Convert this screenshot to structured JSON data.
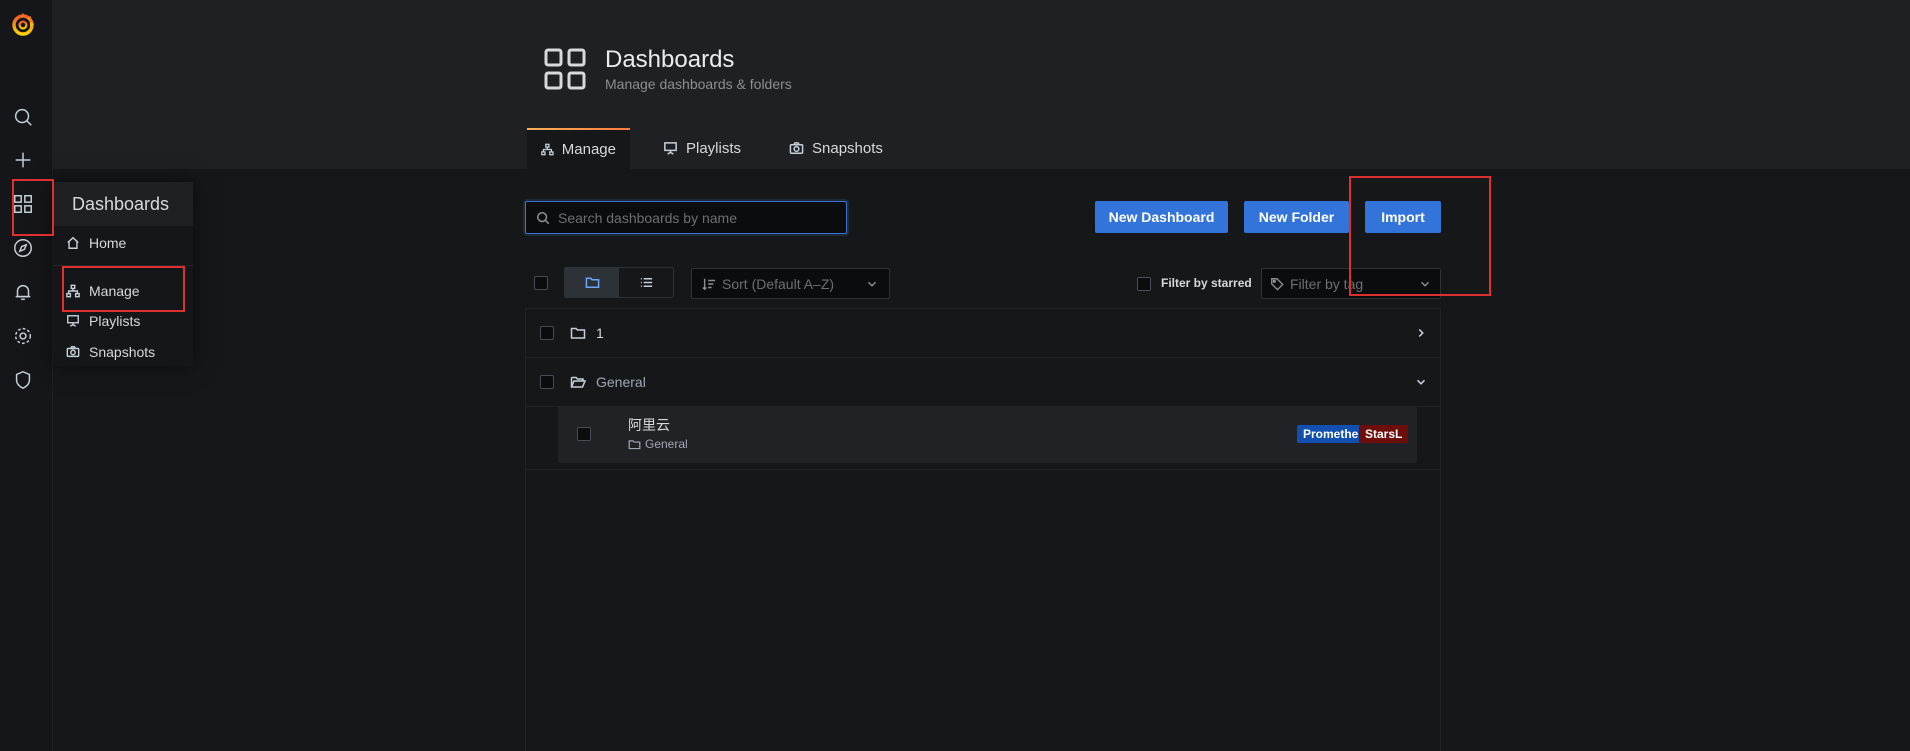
{
  "header": {
    "title": "Dashboards",
    "subtitle": "Manage dashboards & folders"
  },
  "tabs": [
    {
      "label": "Manage",
      "icon": "sitemap-icon",
      "active": true
    },
    {
      "label": "Playlists",
      "icon": "presentation-icon"
    },
    {
      "label": "Snapshots",
      "icon": "camera-icon"
    }
  ],
  "search": {
    "placeholder": "Search dashboards by name",
    "value": ""
  },
  "actions": {
    "new_dashboard": "New Dashboard",
    "new_folder": "New Folder",
    "import": "Import"
  },
  "toolbar": {
    "sort_placeholder": "Sort (Default A–Z)",
    "filter_starred": "Filter by starred",
    "tag_placeholder": "Filter by tag"
  },
  "folders": [
    {
      "name": "1",
      "expanded": false
    },
    {
      "name": "General",
      "expanded": true
    }
  ],
  "dashboards": [
    {
      "title": "阿里云",
      "folder": "General",
      "tags": [
        {
          "label": "Prometheus",
          "color": "#1250b0"
        },
        {
          "label": "StarsL",
          "color": "#6e0e0a"
        }
      ]
    }
  ],
  "menu": {
    "title": "Dashboards",
    "items": [
      "Home",
      "Manage",
      "Playlists",
      "Snapshots"
    ]
  },
  "colors": {
    "accent": "#3274d9",
    "annotation": "#e02f2f"
  }
}
